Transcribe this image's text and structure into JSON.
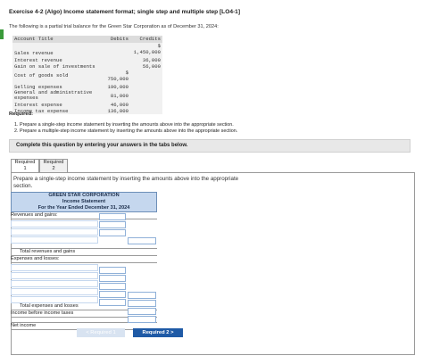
{
  "title": "Exercise 4-2 (Algo) Income statement format; single step and multiple step [LO4-1]",
  "intro": "The following is a partial trial balance for the Green Star Corporation as of December 31, 2024:",
  "trial_balance": {
    "headers": [
      "Account Title",
      "Debits",
      "Credits"
    ],
    "rows": [
      {
        "account": "Sales revenue",
        "debit": "",
        "credit": "$\n1,450,000"
      },
      {
        "account": "Interest revenue",
        "debit": "",
        "credit": "36,000"
      },
      {
        "account": "Gain on sale of investments",
        "debit": "",
        "credit": "56,000"
      },
      {
        "account": "Cost of goods sold",
        "debit": "$\n750,000",
        "credit": ""
      },
      {
        "account": "Selling expenses",
        "debit": "190,000",
        "credit": ""
      },
      {
        "account": "General and administrative expenses",
        "debit": "81,000",
        "credit": ""
      },
      {
        "account": "Interest expense",
        "debit": "46,000",
        "credit": ""
      },
      {
        "account": "Income tax expense",
        "debit": "136,000",
        "credit": ""
      }
    ]
  },
  "required": {
    "label": "Required:",
    "items": [
      "1. Prepare a single-step income statement by inserting the amounts above into the appropriate section.",
      "2. Prepare a multiple-step income statement by inserting the amounts above into the appropriate section."
    ]
  },
  "banner": "Complete this question by entering your answers in the tabs below.",
  "tabs": [
    {
      "line1": "Required",
      "line2": "1"
    },
    {
      "line1": "Required",
      "line2": "2"
    }
  ],
  "prompt": "Prepare a single-step income statement by inserting the amounts above into the appropriate section.",
  "statement": {
    "company": "GREEN STAR CORPORATION",
    "name": "Income Statement",
    "period": "For the Year Ended December 31, 2024",
    "revenues_label": "Revenues and gains:",
    "total_revenues_label": "Total revenues and gains",
    "expenses_label": "Expenses and losses:",
    "total_expenses_label": "Total expenses and losses",
    "income_before_taxes_label": "Income before income taxes",
    "net_income_label": "Net income"
  },
  "nav": {
    "prev": "< Required 1",
    "next": "Required 2 >"
  }
}
